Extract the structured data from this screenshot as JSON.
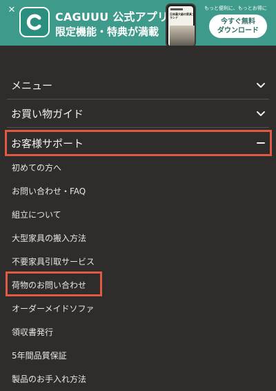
{
  "banner": {
    "title": "CAGUUU 公式アプリ",
    "subtitle": "限定機能・特典が満載",
    "phone_caption": "日本最大級の家具ブランド",
    "tagline": "もっと便利に、もっとお得に",
    "cta_line1": "今すぐ無料",
    "cta_line2": "ダウンロード",
    "close_glyph": "✕",
    "brand_color": "#3e9a8a"
  },
  "menu": {
    "sections": [
      {
        "label": "メニュー",
        "state": "collapsed",
        "icon": "chevron-down-icon"
      },
      {
        "label": "お買い物ガイド",
        "state": "collapsed",
        "icon": "chevron-down-icon"
      },
      {
        "label": "お客様サポート",
        "state": "expanded",
        "icon": "minus-icon"
      }
    ],
    "support_items": [
      "初めての方へ",
      "お問い合わせ・FAQ",
      "組立について",
      "大型家具の搬入方法",
      "不要家具引取サービス",
      "荷物のお問い合わせ",
      "オーダーメイドソファ",
      "領収書発行",
      "5年間品質保証",
      "製品のお手入れ方法"
    ]
  },
  "colors": {
    "background": "#2f2d2b",
    "highlight": "#e15a44",
    "text": "#f2f0ec"
  }
}
